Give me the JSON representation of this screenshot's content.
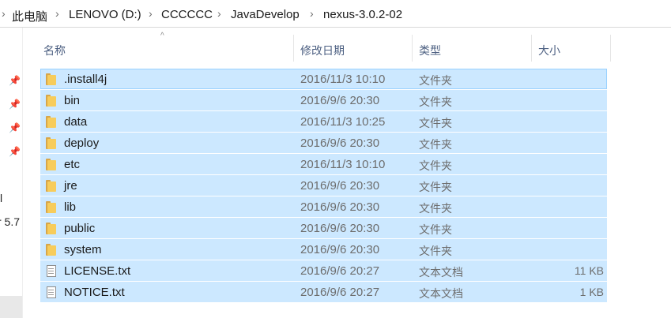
{
  "breadcrumb": {
    "items": [
      "此电脑",
      "LENOVO (D:)",
      "CCCCCC",
      "JavaDevelop",
      "nexus-3.0.2-02"
    ],
    "separator": "›"
  },
  "nav": {
    "partial_texts": [
      "l",
      "r 5.7"
    ]
  },
  "columns": {
    "name": "名称",
    "date": "修改日期",
    "type": "类型",
    "size": "大小"
  },
  "files": [
    {
      "name": ".install4j",
      "date": "2016/11/3 10:10",
      "type": "文件夹",
      "size": "",
      "icon": "folder-icon"
    },
    {
      "name": "bin",
      "date": "2016/9/6 20:30",
      "type": "文件夹",
      "size": "",
      "icon": "folder-icon"
    },
    {
      "name": "data",
      "date": "2016/11/3 10:25",
      "type": "文件夹",
      "size": "",
      "icon": "folder-icon"
    },
    {
      "name": "deploy",
      "date": "2016/9/6 20:30",
      "type": "文件夹",
      "size": "",
      "icon": "folder-icon"
    },
    {
      "name": "etc",
      "date": "2016/11/3 10:10",
      "type": "文件夹",
      "size": "",
      "icon": "folder-icon"
    },
    {
      "name": "jre",
      "date": "2016/9/6 20:30",
      "type": "文件夹",
      "size": "",
      "icon": "folder-icon"
    },
    {
      "name": "lib",
      "date": "2016/9/6 20:30",
      "type": "文件夹",
      "size": "",
      "icon": "folder-icon"
    },
    {
      "name": "public",
      "date": "2016/9/6 20:30",
      "type": "文件夹",
      "size": "",
      "icon": "folder-icon"
    },
    {
      "name": "system",
      "date": "2016/9/6 20:30",
      "type": "文件夹",
      "size": "",
      "icon": "folder-icon"
    },
    {
      "name": "LICENSE.txt",
      "date": "2016/9/6 20:27",
      "type": "文本文档",
      "size": "11 KB",
      "icon": "text-file-icon"
    },
    {
      "name": "NOTICE.txt",
      "date": "2016/9/6 20:27",
      "type": "文本文档",
      "size": "1 KB",
      "icon": "text-file-icon"
    }
  ],
  "colors": {
    "selection": "#cce8ff",
    "selection_border": "#99d1ff",
    "header_text": "#4d6082"
  }
}
